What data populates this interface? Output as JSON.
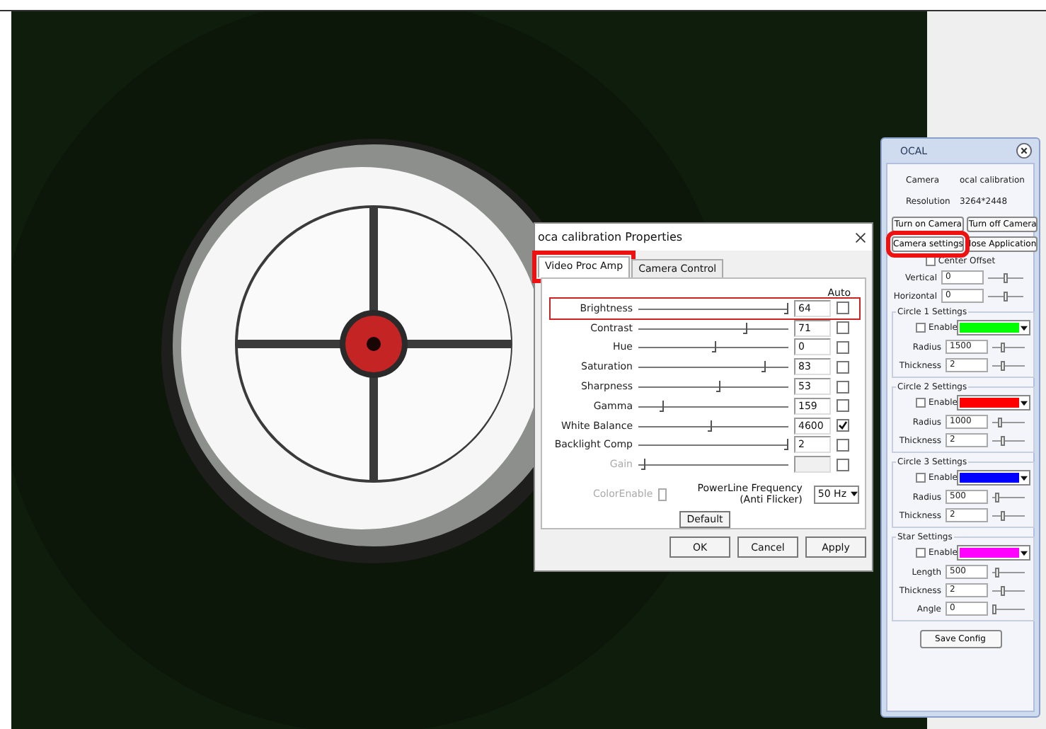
{
  "dialog": {
    "title": "oca calibration Properties",
    "tabs": [
      {
        "label": "Video Proc Amp",
        "selected": true,
        "highlighted": true
      },
      {
        "label": "Camera Control",
        "selected": false,
        "highlighted": false
      }
    ],
    "auto_header": "Auto",
    "properties": [
      {
        "label": "Brightness",
        "level": 1,
        "value": "64",
        "auto": false,
        "disabled": false,
        "highlighted": true
      },
      {
        "label": "Contrast",
        "level": 0.72,
        "value": "71",
        "auto": false,
        "disabled": false,
        "highlighted": false
      },
      {
        "label": "Hue",
        "level": 0.5,
        "value": "0",
        "auto": false,
        "disabled": false,
        "highlighted": false
      },
      {
        "label": "Saturation",
        "level": 0.84,
        "value": "83",
        "auto": false,
        "disabled": false,
        "highlighted": false
      },
      {
        "label": "Sharpness",
        "level": 0.53,
        "value": "53",
        "auto": false,
        "disabled": false,
        "highlighted": false
      },
      {
        "label": "Gamma",
        "level": 0.15,
        "value": "159",
        "auto": false,
        "disabled": false,
        "highlighted": false
      },
      {
        "label": "White Balance",
        "level": 0.48,
        "value": "4600",
        "auto": true,
        "disabled": false,
        "highlighted": false
      },
      {
        "label": "Backlight Comp",
        "level": 1,
        "value": "2",
        "auto": false,
        "disabled": false,
        "highlighted": false
      },
      {
        "label": "Gain",
        "level": 0.02,
        "auto": false,
        "disabled": true,
        "highlighted": false
      }
    ],
    "color_enable": {
      "label": "ColorEnable",
      "checked": false,
      "disabled": true
    },
    "powerline": {
      "label": "PowerLine Frequency",
      "sublabel": "(Anti Flicker)",
      "value": "50 Hz"
    },
    "default_button": "Default",
    "buttons": [
      "OK",
      "Cancel",
      "Apply"
    ]
  },
  "panel": {
    "title": "OCAL",
    "info": [
      {
        "label": "Camera",
        "value": "ocal calibration"
      },
      {
        "label": "Resolution",
        "value": "3264*2448"
      }
    ],
    "buttons": [
      {
        "label": "Turn on Camera",
        "highlighted": false
      },
      {
        "label": "Turn off Camera",
        "highlighted": false
      },
      {
        "label": "Camera settings",
        "highlighted": true
      },
      {
        "label": "lose Application",
        "highlighted": false
      }
    ],
    "center_offset": {
      "label": "Center Offset",
      "checked": false
    },
    "offsets": [
      {
        "label": "Vertical",
        "value": "0",
        "level": 0.5
      },
      {
        "label": "Horizontal",
        "value": "0",
        "level": 0.5
      }
    ],
    "groups": [
      {
        "title": "Circle 1 Settings",
        "enable": {
          "label": "Enable",
          "checked": false
        },
        "color": "#00ff00",
        "fields": [
          {
            "label": "Radius",
            "value": "1500",
            "level": 0.3
          },
          {
            "label": "Thickness",
            "value": "2",
            "level": 0.3
          }
        ]
      },
      {
        "title": "Circle 2 Settings",
        "enable": {
          "label": "Enable",
          "checked": false
        },
        "color": "#ff0000",
        "fields": [
          {
            "label": "Radius",
            "value": "1000",
            "level": 0.2
          },
          {
            "label": "Thickness",
            "value": "2",
            "level": 0.3
          }
        ]
      },
      {
        "title": "Circle 3 Settings",
        "enable": {
          "label": "Enable",
          "checked": false
        },
        "color": "#0000ff",
        "fields": [
          {
            "label": "Radius",
            "value": "500",
            "level": 0.1
          },
          {
            "label": "Thickness",
            "value": "2",
            "level": 0.3
          }
        ]
      },
      {
        "title": "Star Settings",
        "enable": {
          "label": "Enable",
          "checked": false
        },
        "color": "#ff00ff",
        "fields": [
          {
            "label": "Length",
            "value": "500",
            "level": 0.1
          },
          {
            "label": "Thickness",
            "value": "2",
            "level": 0.3
          },
          {
            "label": "Angle",
            "value": "0",
            "level": 0
          }
        ]
      }
    ],
    "save_button": "Save Config"
  }
}
